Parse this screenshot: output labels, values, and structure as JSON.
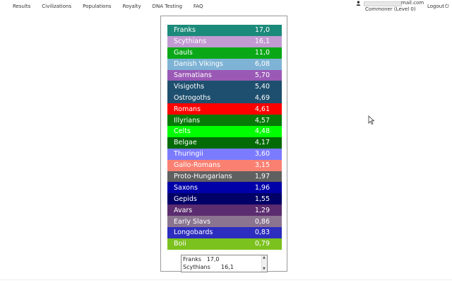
{
  "nav": {
    "items": [
      "Results",
      "Civilizations",
      "Populations",
      "Royalty",
      "DNA Testing",
      "FAQ"
    ]
  },
  "user": {
    "email_suffix": "mail.com",
    "rank": "Commoner (Level 0)",
    "logout_label": "Logout",
    "icons": {
      "user": "user-icon",
      "logout": "logout-icon"
    }
  },
  "results": [
    {
      "name": "Franks",
      "value": "17,0",
      "color": "#1b8a7a"
    },
    {
      "name": "Scythians",
      "value": "16,1",
      "color": "#c39bd3"
    },
    {
      "name": "Gauls",
      "value": "11,0",
      "color": "#0aa817"
    },
    {
      "name": "Danish Vikings",
      "value": "6,08",
      "color": "#7fb3d5"
    },
    {
      "name": "Sarmatians",
      "value": "5,70",
      "color": "#9b59b6"
    },
    {
      "name": "Visigoths",
      "value": "5,40",
      "color": "#1e4f6e"
    },
    {
      "name": "Ostrogoths",
      "value": "4,69",
      "color": "#1e4f6e"
    },
    {
      "name": "Romans",
      "value": "4,61",
      "color": "#ff0000"
    },
    {
      "name": "Illyrians",
      "value": "4,57",
      "color": "#087a08"
    },
    {
      "name": "Celts",
      "value": "4,48",
      "color": "#00ff00"
    },
    {
      "name": "Belgae",
      "value": "4,17",
      "color": "#036b05"
    },
    {
      "name": "Thuringii",
      "value": "3,60",
      "color": "#7b7bff"
    },
    {
      "name": "Gallo-Romans",
      "value": "3,15",
      "color": "#fa8072"
    },
    {
      "name": "Proto-Hungarians",
      "value": "1,97",
      "color": "#606060"
    },
    {
      "name": "Saxons",
      "value": "1,96",
      "color": "#0000a8"
    },
    {
      "name": "Gepids",
      "value": "1,55",
      "color": "#000066"
    },
    {
      "name": "Avars",
      "value": "1,29",
      "color": "#5b2c6f"
    },
    {
      "name": "Early Slavs",
      "value": "0,86",
      "color": "#8a7490"
    },
    {
      "name": "Longobards",
      "value": "0,83",
      "color": "#2d2dbf"
    },
    {
      "name": "Boii",
      "value": "0,79",
      "color": "#7cc21f"
    }
  ],
  "list_box": {
    "lines": [
      "Franks   17,0",
      "Scythians      16,1"
    ]
  }
}
